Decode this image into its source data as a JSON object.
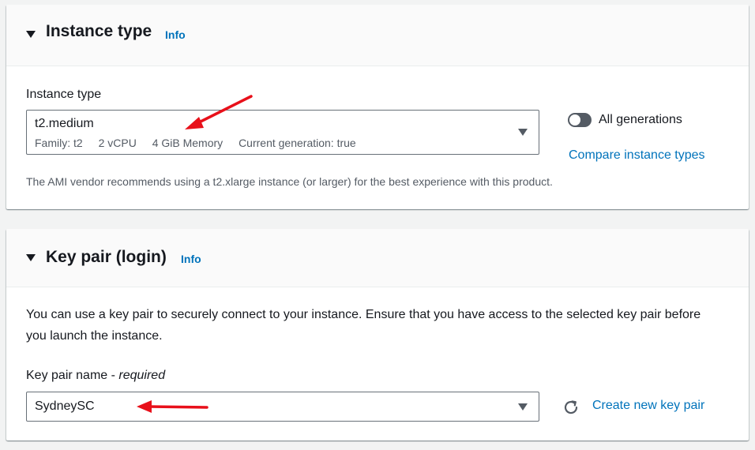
{
  "instance_type_panel": {
    "title": "Instance type",
    "info": "Info",
    "field_label": "Instance type",
    "selected": {
      "value": "t2.medium",
      "tags": [
        "Family: t2",
        "2 vCPU",
        "4 GiB Memory",
        "Current generation: true"
      ]
    },
    "all_generations_label": "All generations",
    "all_generations_on": false,
    "compare_link": "Compare instance types",
    "hint": "The AMI vendor recommends using a t2.xlarge instance (or larger) for the best experience with this product."
  },
  "key_pair_panel": {
    "title": "Key pair (login)",
    "info": "Info",
    "description": "You can use a key pair to securely connect to your instance. Ensure that you have access to the selected key pair before you launch the instance.",
    "field_label": "Key pair name",
    "field_required": "required",
    "selected_value": "SydneySC",
    "create_link": "Create new key pair"
  },
  "icons": {
    "collapse": "caret-down-icon",
    "dropdown": "dropdown-caret-icon",
    "refresh": "refresh-icon",
    "annotation": "red-arrow-icon"
  },
  "colors": {
    "link": "#0073bb",
    "text": "#16191f",
    "secondary_text": "#545b64",
    "annotation": "#e8101a",
    "background": "#f2f3f3"
  }
}
